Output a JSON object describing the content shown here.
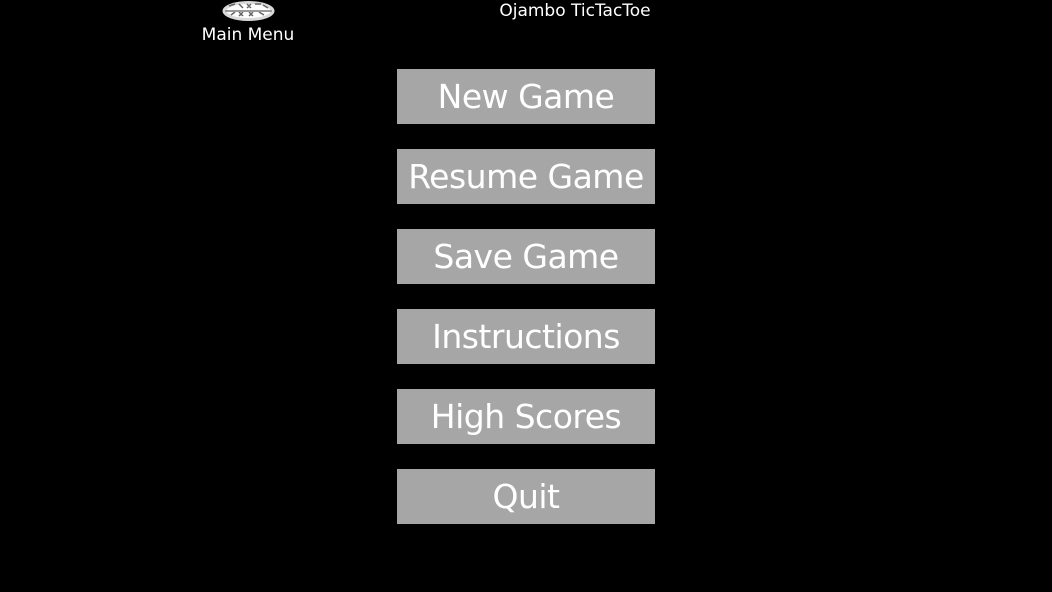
{
  "header": {
    "app_title": "Ojambo TicTacToe",
    "menu_title": "Main Menu",
    "logo_icon": "game-logo-icon"
  },
  "menu": {
    "items": [
      {
        "label": "New Game"
      },
      {
        "label": "Resume Game"
      },
      {
        "label": "Save Game"
      },
      {
        "label": "Instructions"
      },
      {
        "label": "High Scores"
      },
      {
        "label": "Quit"
      }
    ]
  },
  "colors": {
    "background": "#000000",
    "button_background": "#a6a6a6",
    "text": "#ffffff"
  }
}
